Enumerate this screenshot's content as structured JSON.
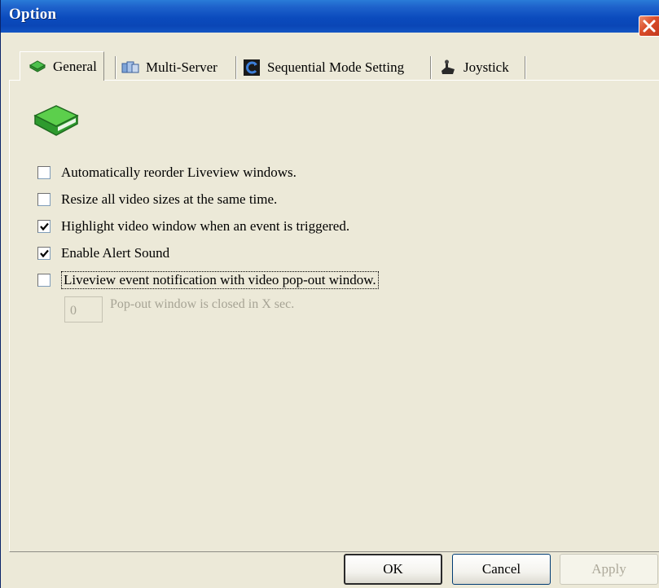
{
  "window": {
    "title": "Option"
  },
  "tabs": [
    {
      "label": "General",
      "icon": "green-book-icon",
      "active": true
    },
    {
      "label": "Multi-Server",
      "icon": "servers-icon",
      "active": false
    },
    {
      "label": "Sequential Mode Setting",
      "icon": "sequence-icon",
      "active": false
    },
    {
      "label": "Joystick",
      "icon": "joystick-icon",
      "active": false
    }
  ],
  "options": [
    {
      "label": "Automatically reorder Liveview windows.",
      "checked": false
    },
    {
      "label": "Resize all video sizes at the same time.",
      "checked": false
    },
    {
      "label": "Highlight video window when an event is triggered.",
      "checked": true
    },
    {
      "label": "Enable Alert Sound",
      "checked": true
    },
    {
      "label": "Liveview event notification with video pop-out window.",
      "checked": false
    }
  ],
  "popout": {
    "value": "0",
    "label": "Pop-out window is closed in X sec.",
    "enabled": false
  },
  "buttons": {
    "ok": "OK",
    "cancel": "Cancel",
    "apply": "Apply"
  },
  "colors": {
    "titlebar": "#0a46b6",
    "background": "#ece9d8",
    "close": "#d94d2a",
    "book": "#3aa63a"
  }
}
